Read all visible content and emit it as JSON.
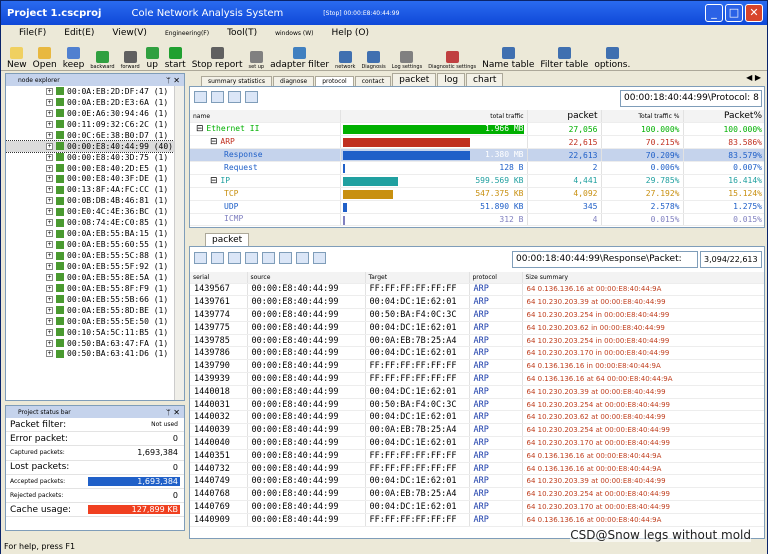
{
  "title": {
    "project": "Project 1.cscproj",
    "app": "Cole Network Analysis System",
    "status": "[Stop] 00:00:E8:40:44:99"
  },
  "title_buttons": {
    "min": "_",
    "max": "□",
    "close": "✕"
  },
  "menu": [
    "File(F)",
    "Edit(E)",
    "View(V)",
    "Engineering(F)",
    "Tool(T)",
    "windows (W)",
    "Help (O)"
  ],
  "toolbar": [
    {
      "label": "New",
      "icon": "new-icon",
      "small": false,
      "color": "#f0d060"
    },
    {
      "label": "Open",
      "icon": "open-folder-icon",
      "small": false,
      "color": "#e8b840"
    },
    {
      "label": "keep",
      "icon": "save-icon",
      "small": false,
      "color": "#5080d0"
    },
    {
      "label": "backward",
      "icon": "back-arrow-icon",
      "small": true,
      "color": "#30a040"
    },
    {
      "label": "forward",
      "icon": "forward-arrow-icon",
      "small": true,
      "color": "#606060"
    },
    {
      "label": "up",
      "icon": "up-arrow-icon",
      "small": false,
      "color": "#30a040"
    },
    {
      "label": "start",
      "icon": "play-icon",
      "small": false,
      "color": "#20a030"
    },
    {
      "label": "Stop report",
      "icon": "stop-icon",
      "small": false,
      "color": "#606060"
    },
    {
      "label": "set up",
      "icon": "settings-icon",
      "small": true,
      "color": "#808080"
    },
    {
      "label": "adapter filter",
      "icon": "adapter-icon",
      "small": false,
      "color": "#4080c0"
    },
    {
      "label": "network",
      "icon": "network-icon",
      "small": true,
      "color": "#4070b0"
    },
    {
      "label": "Diagnosis",
      "icon": "diagnosis-icon",
      "small": true,
      "color": "#4070b0"
    },
    {
      "label": "Log settings",
      "icon": "log-icon",
      "small": true,
      "color": "#808080"
    },
    {
      "label": "Diagnostic settings",
      "icon": "diag-settings-icon",
      "small": true,
      "color": "#c04040"
    },
    {
      "label": "Name table",
      "icon": "name-table-icon",
      "small": false,
      "color": "#4070b0"
    },
    {
      "label": "Filter table",
      "icon": "filter-table-icon",
      "small": false,
      "color": "#4070b0"
    },
    {
      "label": "options.",
      "icon": "options-icon",
      "small": false,
      "color": "#4070b0"
    }
  ],
  "node_explorer": {
    "title": "node explorer",
    "pin": "ᛘ",
    "close": "✕",
    "items": [
      "00:0A:EB:2D:DF:47 (1)",
      "00:0A:EB:2D:E3:6A (1)",
      "00:0E:A6:30:94:46 (1)",
      "00:11:09:32:C6:2C (1)",
      "00:0C:6E:38:B0:D7 (1)",
      "00:00:E8:40:44:99 (40)",
      "00:00:E8:40:3D:75 (1)",
      "00:00:E8:40:2D:E5 (1)",
      "00:00:E8:40:3F:DE (1)",
      "00:13:8F:4A:FC:CC (1)",
      "00:0B:DB:4B:46:81 (1)",
      "00:E0:4C:4E:36:BC (1)",
      "00:08:74:4E:C0:85 (1)",
      "00:0A:EB:55:BA:15 (1)",
      "00:0A:EB:55:60:55 (1)",
      "00:0A:EB:55:5C:88 (1)",
      "00:0A:EB:55:5F:92 (1)",
      "00:0A:EB:55:8E:5A (1)",
      "00:0A:EB:55:8F:F9 (1)",
      "00:0A:EB:55:5B:66 (1)",
      "00:0A:EB:55:8D:BE (1)",
      "00:0A:EB:55:5E:50 (1)",
      "00:10:5A:5C:11:B5 (1)",
      "00:50:BA:63:47:FA (1)",
      "00:50:BA:63:41:D6 (1)"
    ],
    "selected": 5
  },
  "status_bar": {
    "title": "Project status bar",
    "rows": [
      {
        "label": "Packet filter:",
        "value": "Not used",
        "small_label": false,
        "small_value": true,
        "color": ""
      },
      {
        "label": "Error packet:",
        "value": "0",
        "small_label": false,
        "small_value": false,
        "color": ""
      },
      {
        "label": "Captured packets:",
        "value": "1,693,384",
        "small_label": true,
        "small_value": false,
        "color": ""
      },
      {
        "label": "Lost packets:",
        "value": "0",
        "small_label": false,
        "small_value": false,
        "color": ""
      },
      {
        "label": "Accepted packets:",
        "value": "1,693,384",
        "small_label": true,
        "small_value": false,
        "color": "#2060c8"
      },
      {
        "label": "Rejected packets:",
        "value": "0",
        "small_label": true,
        "small_value": false,
        "color": ""
      },
      {
        "label": "Cache usage:",
        "value": "127,899 KB",
        "small_label": false,
        "small_value": false,
        "color": "#f04020"
      }
    ]
  },
  "tabs": [
    {
      "label": "summary statistics",
      "big": false
    },
    {
      "label": "diagnose",
      "big": false
    },
    {
      "label": "protocol",
      "big": false,
      "active": true
    },
    {
      "label": "contact",
      "big": false
    },
    {
      "label": "packet",
      "big": true
    },
    {
      "label": "log",
      "big": true
    },
    {
      "label": "chart",
      "big": true
    }
  ],
  "tab_nav": "◀ ▶",
  "protocol_readout": "00:00:18:40:44:99\\Protocol: 8",
  "summary_headers": {
    "name": "name",
    "traffic": "total traffic",
    "packet": "packet",
    "total_pct": "Total traffic %",
    "packet_pct": "Packet%"
  },
  "summary_rows": [
    {
      "name": "Ethernet II",
      "indent": 0,
      "traffic": "1.966 MB",
      "traffic_mb": 1.966,
      "packet": "27,056",
      "tpct": "100.000%",
      "ppct": "100.000%",
      "color": "#00b000",
      "sel": false
    },
    {
      "name": "ARP",
      "indent": 1,
      "traffic": "1.380 MB",
      "traffic_mb": 1.38,
      "packet": "22,615",
      "tpct": "70.215%",
      "ppct": "83.586%",
      "color": "#c03020",
      "sel": false
    },
    {
      "name": "Response",
      "indent": 2,
      "traffic": "1.380 MB",
      "traffic_mb": 1.38,
      "packet": "22,613",
      "tpct": "70.209%",
      "ppct": "83.579%",
      "color": "#2060c8",
      "sel": true
    },
    {
      "name": "Request",
      "indent": 2,
      "traffic": "128 B",
      "traffic_mb": 0.000128,
      "packet": "2",
      "tpct": "0.006%",
      "ppct": "0.007%",
      "color": "#2060c8",
      "sel": false
    },
    {
      "name": "IP",
      "indent": 1,
      "traffic": "599.569 KB",
      "traffic_mb": 0.5996,
      "packet": "4,441",
      "tpct": "29.785%",
      "ppct": "16.414%",
      "color": "#20a0a0",
      "sel": false
    },
    {
      "name": "TCP",
      "indent": 2,
      "traffic": "547.375 KB",
      "traffic_mb": 0.5474,
      "packet": "4,092",
      "tpct": "27.192%",
      "ppct": "15.124%",
      "color": "#c89010",
      "sel": false
    },
    {
      "name": "UDP",
      "indent": 2,
      "traffic": "51.890 KB",
      "traffic_mb": 0.0519,
      "packet": "345",
      "tpct": "2.578%",
      "ppct": "1.275%",
      "color": "#2060c8",
      "sel": false
    },
    {
      "name": "ICMP",
      "indent": 2,
      "traffic": "312 B",
      "traffic_mb": 0.000312,
      "packet": "4",
      "tpct": "0.015%",
      "ppct": "0.015%",
      "color": "#8080c0",
      "sel": false
    }
  ],
  "traffic_max_mb": 1.966,
  "packet_tab": "packet",
  "packet_readout": "00:00:18:40:44:99\\Response\\Packet:",
  "packet_count": "3,094/22,613",
  "packet_headers": {
    "num": "serial",
    "source": "source",
    "target": "Target",
    "protocol": "protocol",
    "size": "Size summary"
  },
  "packets": [
    {
      "num": "1439567",
      "src": "00:00:E8:40:44:99",
      "dst": "FF:FF:FF:FF:FF:FF",
      "proto": "ARP",
      "sum": "64 0.136.136.16 at 00:00:E8:40:44:9A"
    },
    {
      "num": "1439761",
      "src": "00:00:E8:40:44:99",
      "dst": "00:04:DC:1E:62:01",
      "proto": "ARP",
      "sum": "64 10.230.203.39 at 00:00:E8:40:44:99"
    },
    {
      "num": "1439774",
      "src": "00:00:E8:40:44:99",
      "dst": "00:50:BA:F4:0C:3C",
      "proto": "ARP",
      "sum": "64 10.230.203.254 in 00:00:E8:40:44:99"
    },
    {
      "num": "1439775",
      "src": "00:00:E8:40:44:99",
      "dst": "00:04:DC:1E:62:01",
      "proto": "ARP",
      "sum": "64 10.230.203.62 in 00:00:E8:40:44:99"
    },
    {
      "num": "1439785",
      "src": "00:00:E8:40:44:99",
      "dst": "00:0A:EB:7B:25:A4",
      "proto": "ARP",
      "sum": "64 10.230.203.254 in 00:00:E8:40:44:99"
    },
    {
      "num": "1439786",
      "src": "00:00:E8:40:44:99",
      "dst": "00:04:DC:1E:62:01",
      "proto": "ARP",
      "sum": "64 10.230.203.170 in 00:00:E8:40:44:99"
    },
    {
      "num": "1439790",
      "src": "00:00:E8:40:44:99",
      "dst": "FF:FF:FF:FF:FF:FF",
      "proto": "ARP",
      "sum": "64 0.136.136.16 in 00:00:E8:40:44:9A"
    },
    {
      "num": "1439939",
      "src": "00:00:E8:40:44:99",
      "dst": "FF:FF:FF:FF:FF:FF",
      "proto": "ARP",
      "sum": "64 0.136.136.16 at 64 00:00:E8:40:44:9A"
    },
    {
      "num": "1440018",
      "src": "00:00:E8:40:44:99",
      "dst": "00:04:DC:1E:62:01",
      "proto": "ARP",
      "sum": "64 10.230.203.39 at 00:00:E8:40:44:99"
    },
    {
      "num": "1440031",
      "src": "00:00:E8:40:44:99",
      "dst": "00:50:BA:F4:0C:3C",
      "proto": "ARP",
      "sum": "64 10.230.203.254 at 00:00:E8:40:44:99"
    },
    {
      "num": "1440032",
      "src": "00:00:E8:40:44:99",
      "dst": "00:04:DC:1E:62:01",
      "proto": "ARP",
      "sum": "64 10.230.203.62 at 00:00:E8:40:44:99"
    },
    {
      "num": "1440039",
      "src": "00:00:E8:40:44:99",
      "dst": "00:0A:EB:7B:25:A4",
      "proto": "ARP",
      "sum": "64 10.230.203.254 at 00:00:E8:40:44:99"
    },
    {
      "num": "1440040",
      "src": "00:00:E8:40:44:99",
      "dst": "00:04:DC:1E:62:01",
      "proto": "ARP",
      "sum": "64 10.230.203.170 at 00:00:E8:40:44:99"
    },
    {
      "num": "1440351",
      "src": "00:00:E8:40:44:99",
      "dst": "FF:FF:FF:FF:FF:FF",
      "proto": "ARP",
      "sum": "64 0.136.136.16 at 00:00:E8:40:44:9A"
    },
    {
      "num": "1440732",
      "src": "00:00:E8:40:44:99",
      "dst": "FF:FF:FF:FF:FF:FF",
      "proto": "ARP",
      "sum": "64 0.136.136.16 at 00:00:E8:40:44:9A"
    },
    {
      "num": "1440749",
      "src": "00:00:E8:40:44:99",
      "dst": "00:04:DC:1E:62:01",
      "proto": "ARP",
      "sum": "64 10.230.203.39 at 00:00:E8:40:44:99"
    },
    {
      "num": "1440768",
      "src": "00:00:E8:40:44:99",
      "dst": "00:0A:EB:7B:25:A4",
      "proto": "ARP",
      "sum": "64 10.230.203.254 at 00:00:E8:40:44:99"
    },
    {
      "num": "1440769",
      "src": "00:00:E8:40:44:99",
      "dst": "00:04:DC:1E:62:01",
      "proto": "ARP",
      "sum": "64 10.230.203.170 at 00:00:E8:40:44:99"
    },
    {
      "num": "1440909",
      "src": "00:00:E8:40:44:99",
      "dst": "FF:FF:FF:FF:FF:FF",
      "proto": "ARP",
      "sum": "64 0.136.136.16 at 00:00:E8:40:44:9A"
    }
  ],
  "footer": "For help, press F1",
  "watermark": "CSD@Snow legs without mold"
}
